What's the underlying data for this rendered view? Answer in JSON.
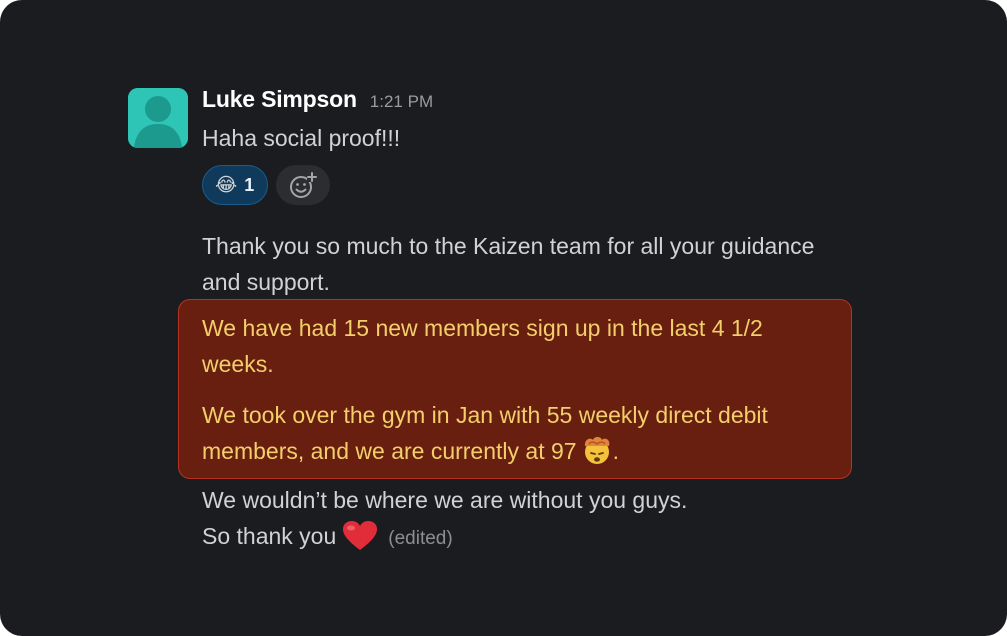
{
  "message": {
    "author": "Luke Simpson",
    "timestamp": "1:21 PM",
    "text": "Haha social proof!!!",
    "avatar_icon": "user-silhouette-icon",
    "avatar_color": "#2ec4b6"
  },
  "reactions": [
    {
      "emoji": "😂",
      "icon": "joy-emoji-icon",
      "count": "1"
    }
  ],
  "add_reaction_icon": "add-reaction-icon",
  "followup": {
    "line1": "Thank you so much to the Kaizen team for all your guidance",
    "line2": "and support."
  },
  "highlight": {
    "color": "#691f10",
    "border_color": "#b43224",
    "text_color": "#f2cf6b",
    "p1_line1": "We have had 15 new members sign up in the last 4 1/2",
    "p1_line2": "weeks.",
    "p2_line1": "We took over the gym in Jan with 55 weekly direct debit",
    "p2_line2": "members, and we are currently at 97",
    "p2_emoji_icon": "exploding-head-emoji-icon",
    "p2_end": "."
  },
  "closing": {
    "line1": "We wouldn’t be where we are without you guys.",
    "line2": "So thank you",
    "heart_icon": "red-heart-emoji-icon",
    "edited": "(edited)"
  }
}
